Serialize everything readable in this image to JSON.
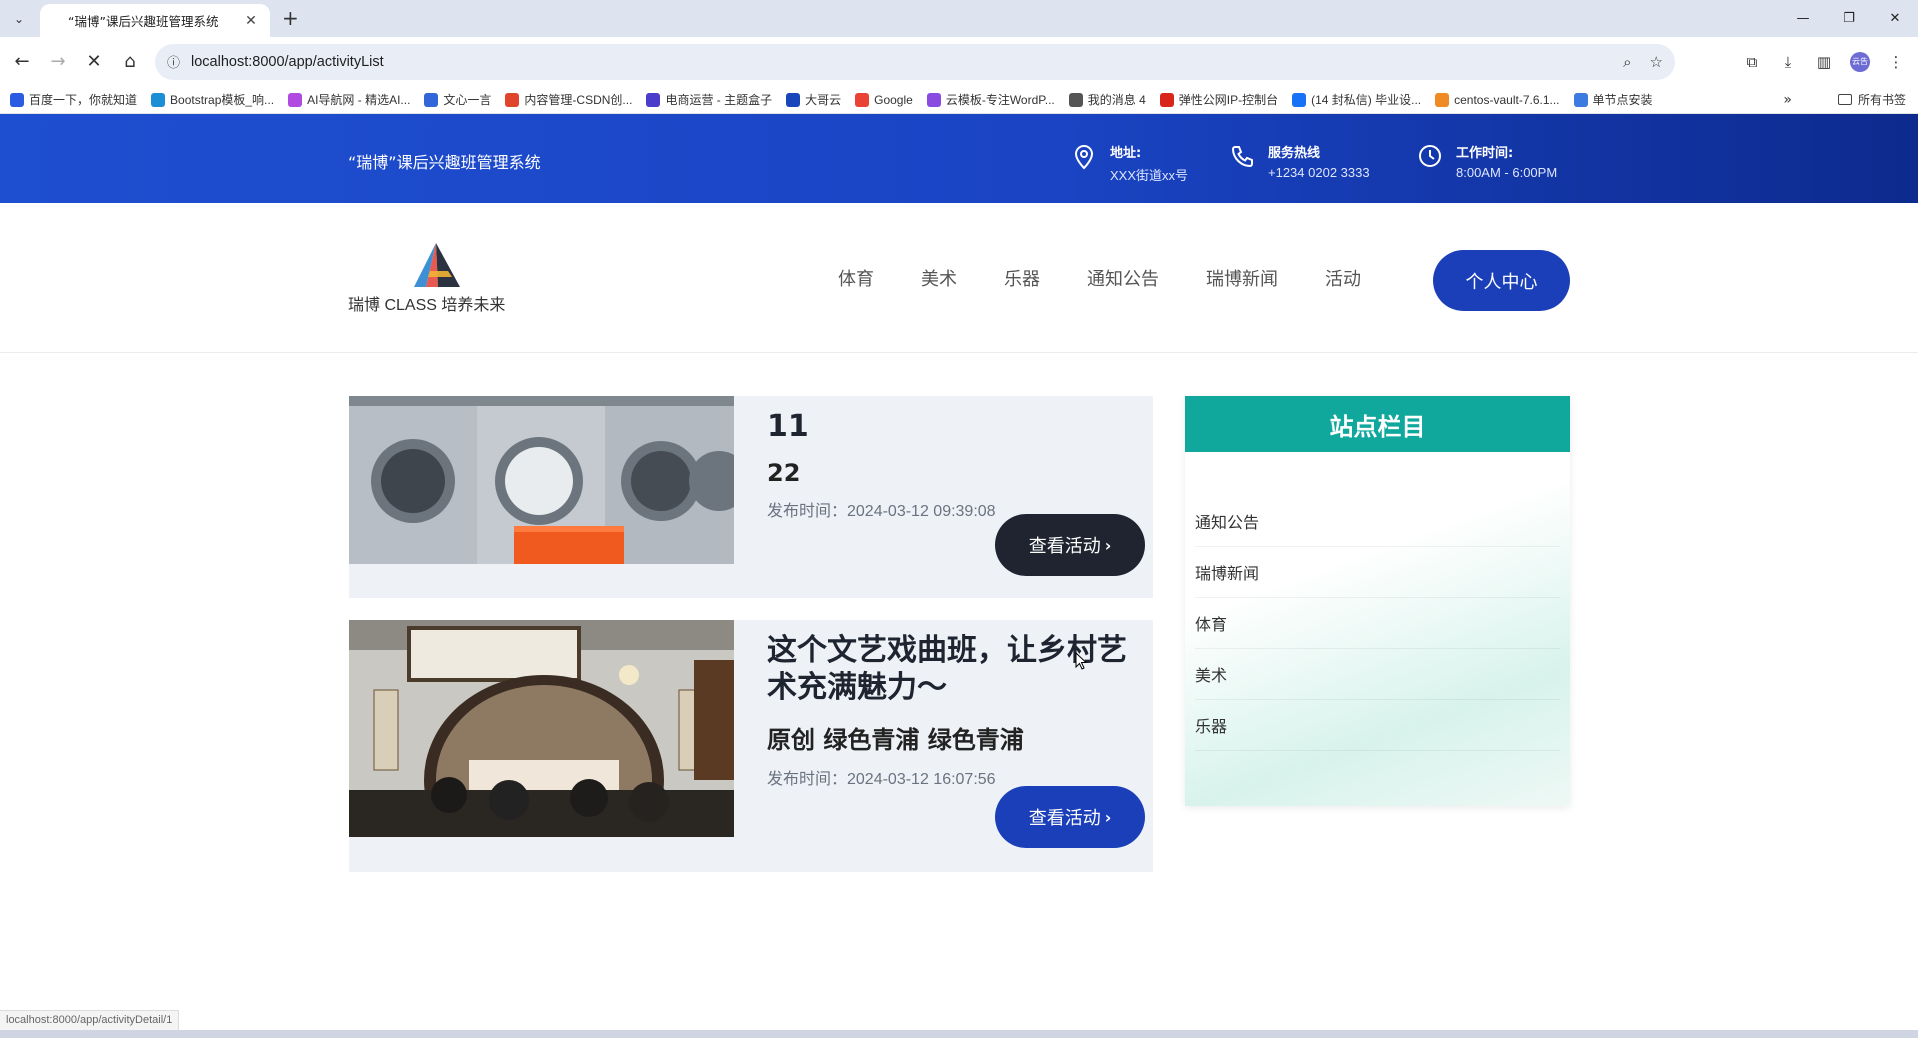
{
  "browser": {
    "tab_title": "“瑞博”课后兴趣班管理系统",
    "url": "localhost:8000/app/activityList",
    "status_url": "localhost:8000/app/activityDetail/1",
    "profile_label": "云告",
    "bookmarks": [
      {
        "label": "百度一下，你就知道",
        "color": "#2b5be0"
      },
      {
        "label": "Bootstrap模板_响...",
        "color": "#1a8fd6"
      },
      {
        "label": "AI导航网 - 精选AI...",
        "color": "#b04ae0"
      },
      {
        "label": "文心一言",
        "color": "#3265d8"
      },
      {
        "label": "内容管理-CSDN创...",
        "color": "#e0452b"
      },
      {
        "label": "电商运营 - 主题盒子",
        "color": "#4b3cc9"
      },
      {
        "label": "大哥云",
        "color": "#1946b8"
      },
      {
        "label": "Google",
        "color": "#ea4335"
      },
      {
        "label": "云模板-专注WordP...",
        "color": "#8a4be0"
      },
      {
        "label": "我的消息 4",
        "color": "#555555"
      },
      {
        "label": "弹性公网IP-控制台",
        "color": "#d9261c"
      },
      {
        "label": "(14 封私信) 毕业设...",
        "color": "#1772f6"
      },
      {
        "label": "centos-vault-7.6.1...",
        "color": "#f08a24"
      },
      {
        "label": "单节点安装",
        "color": "#3d7be0"
      }
    ],
    "bookmarks_more": "»",
    "all_bookmarks": "所有书签"
  },
  "header": {
    "site_title": "“瑞博”课后兴趣班管理系统",
    "address_label": "地址:",
    "address_value": "XXX街道xx号",
    "hotline_label": "服务热线",
    "hotline_value": "+1234 0202 3333",
    "hours_label": "工作时间:",
    "hours_value": "8:00AM - 6:00PM"
  },
  "nav": {
    "logo_text": "瑞博 CLASS 培养未来",
    "items": [
      "体育",
      "美术",
      "乐器",
      "通知公告",
      "瑞博新闻",
      "活动"
    ],
    "personal_center": "个人中心"
  },
  "activities": [
    {
      "title": "11",
      "subtitle": "22",
      "time": "发布时间：2024-03-12 09:39:08",
      "button": "查看活动"
    },
    {
      "title": "这个文艺戏曲班，让乡村艺术充满魅力～",
      "subtitle": "原创 绿色青浦 绿色青浦",
      "time": "发布时间：2024-03-12 16:07:56",
      "button": "查看活动"
    }
  ],
  "sidebar": {
    "title": "站点栏目",
    "items": [
      "通知公告",
      "瑞博新闻",
      "体育",
      "美术",
      "乐器"
    ]
  },
  "colors": {
    "header_blue": "#1e4fd0",
    "button_blue": "#1a3fb8",
    "button_dark": "#1f2430",
    "sidebar_teal": "#10a89d"
  }
}
